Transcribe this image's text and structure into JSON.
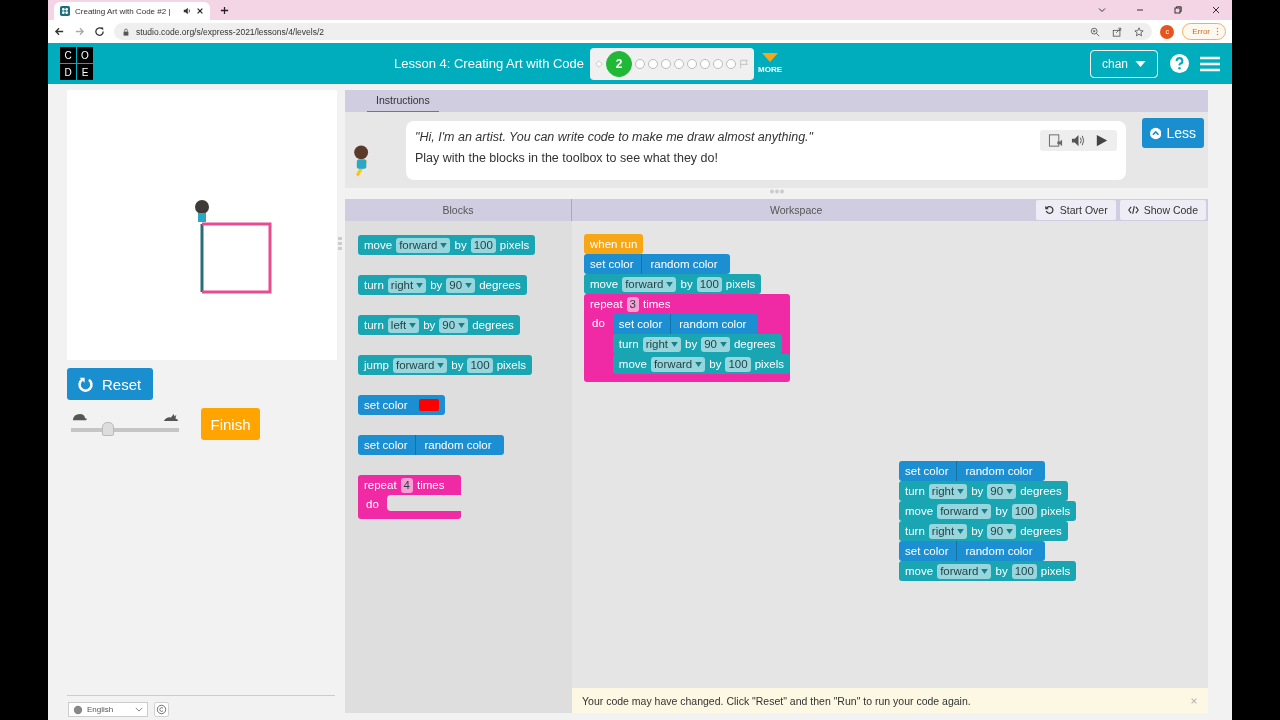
{
  "browser": {
    "tab_title": "Creating Art with Code #2 |",
    "url": "studio.code.org/s/express-2021/lessons/4/levels/2",
    "profile": "c",
    "error_button": "Error"
  },
  "header": {
    "logo": [
      "C",
      "O",
      "D",
      "E"
    ],
    "lesson_title": "Lesson 4: Creating Art with Code",
    "levels": [
      {
        "kind": "diamond",
        "selected": false
      },
      {
        "kind": "bubble",
        "label": "2",
        "selected": true
      },
      {
        "kind": "bubble",
        "selected": false
      },
      {
        "kind": "bubble",
        "selected": false
      },
      {
        "kind": "bubble",
        "selected": false
      },
      {
        "kind": "bubble",
        "selected": false
      },
      {
        "kind": "bubble",
        "selected": false
      },
      {
        "kind": "bubble",
        "selected": false
      },
      {
        "kind": "bubble",
        "selected": false
      },
      {
        "kind": "bubble",
        "selected": false
      },
      {
        "kind": "flag",
        "selected": false
      }
    ],
    "more": "MORE",
    "user": "chan"
  },
  "controls": {
    "reset": "Reset",
    "finish": "Finish",
    "speed": {
      "level": 0.34
    }
  },
  "instructions": {
    "tab": "Instructions",
    "quote": "\"Hi, I'm an artist. You can write code to make me draw almost anything.\"",
    "text": "Play with the blocks in the toolbox to see what they do!",
    "less_button": "Less"
  },
  "toolbox": {
    "title": "Blocks",
    "blocks": [
      {
        "kind": "motion",
        "parts": [
          {
            "kind": "text",
            "text": "move"
          },
          {
            "kind": "dropdown",
            "text": "forward"
          },
          {
            "kind": "text",
            "text": "by"
          },
          {
            "kind": "number",
            "text": "100"
          },
          {
            "kind": "text",
            "text": "pixels"
          }
        ]
      },
      {
        "kind": "motion",
        "parts": [
          {
            "kind": "text",
            "text": "turn"
          },
          {
            "kind": "dropdown",
            "text": "right"
          },
          {
            "kind": "text",
            "text": "by"
          },
          {
            "kind": "dropdown",
            "text": "90"
          },
          {
            "kind": "text",
            "text": "degrees"
          }
        ]
      },
      {
        "kind": "motion",
        "parts": [
          {
            "kind": "text",
            "text": "turn"
          },
          {
            "kind": "dropdown",
            "text": "left"
          },
          {
            "kind": "text",
            "text": "by"
          },
          {
            "kind": "dropdown",
            "text": "90"
          },
          {
            "kind": "text",
            "text": "degrees"
          }
        ]
      },
      {
        "kind": "motion",
        "parts": [
          {
            "kind": "text",
            "text": "jump"
          },
          {
            "kind": "dropdown",
            "text": "forward"
          },
          {
            "kind": "text",
            "text": "by"
          },
          {
            "kind": "number",
            "text": "100"
          },
          {
            "kind": "text",
            "text": "pixels"
          }
        ]
      },
      {
        "kind": "color",
        "parts": [
          {
            "kind": "text",
            "text": "set color"
          },
          {
            "kind": "swatch",
            "color": "#ff0000"
          }
        ]
      },
      {
        "kind": "color",
        "parts": [
          {
            "kind": "text",
            "text": "set color"
          },
          {
            "kind": "sub",
            "text": "random color"
          }
        ]
      },
      {
        "kind": "loop",
        "parts": [
          {
            "kind": "text",
            "text": "repeat"
          },
          {
            "kind": "number",
            "text": "4"
          },
          {
            "kind": "text",
            "text": "times"
          }
        ],
        "do_label": "do"
      }
    ]
  },
  "workspace": {
    "title": "Workspace",
    "start_over": "Start Over",
    "show_code": "Show Code",
    "stacks": [
      {
        "blocks": [
          {
            "kind": "event",
            "parts": [
              {
                "kind": "text",
                "text": "when run"
              }
            ]
          },
          {
            "kind": "color",
            "parts": [
              {
                "kind": "text",
                "text": "set color"
              },
              {
                "kind": "sub",
                "text": "random color"
              }
            ]
          },
          {
            "kind": "motion",
            "parts": [
              {
                "kind": "text",
                "text": "move"
              },
              {
                "kind": "dropdown",
                "text": "forward"
              },
              {
                "kind": "text",
                "text": "by"
              },
              {
                "kind": "number",
                "text": "100"
              },
              {
                "kind": "text",
                "text": "pixels"
              }
            ]
          },
          {
            "kind": "loop",
            "parts": [
              {
                "kind": "text",
                "text": "repeat"
              },
              {
                "kind": "number",
                "text": "3"
              },
              {
                "kind": "text",
                "text": "times"
              }
            ],
            "do_label": "do",
            "children": [
              {
                "kind": "color",
                "parts": [
                  {
                    "kind": "text",
                    "text": "set color"
                  },
                  {
                    "kind": "sub",
                    "text": "random color"
                  }
                ]
              },
              {
                "kind": "motion",
                "parts": [
                  {
                    "kind": "text",
                    "text": "turn"
                  },
                  {
                    "kind": "dropdown",
                    "text": "right"
                  },
                  {
                    "kind": "text",
                    "text": "by"
                  },
                  {
                    "kind": "dropdown",
                    "text": "90"
                  },
                  {
                    "kind": "text",
                    "text": "degrees"
                  }
                ]
              },
              {
                "kind": "motion",
                "parts": [
                  {
                    "kind": "text",
                    "text": "move"
                  },
                  {
                    "kind": "dropdown",
                    "text": "forward"
                  },
                  {
                    "kind": "text",
                    "text": "by"
                  },
                  {
                    "kind": "number",
                    "text": "100"
                  },
                  {
                    "kind": "text",
                    "text": "pixels"
                  }
                ]
              }
            ]
          }
        ]
      },
      {
        "blocks": [
          {
            "kind": "color",
            "parts": [
              {
                "kind": "text",
                "text": "set color"
              },
              {
                "kind": "sub",
                "text": "random color"
              }
            ]
          },
          {
            "kind": "motion",
            "parts": [
              {
                "kind": "text",
                "text": "turn"
              },
              {
                "kind": "dropdown",
                "text": "right"
              },
              {
                "kind": "text",
                "text": "by"
              },
              {
                "kind": "dropdown",
                "text": "90"
              },
              {
                "kind": "text",
                "text": "degrees"
              }
            ]
          },
          {
            "kind": "motion",
            "parts": [
              {
                "kind": "text",
                "text": "move"
              },
              {
                "kind": "dropdown",
                "text": "forward"
              },
              {
                "kind": "text",
                "text": "by"
              },
              {
                "kind": "number",
                "text": "100"
              },
              {
                "kind": "text",
                "text": "pixels"
              }
            ]
          },
          {
            "kind": "motion",
            "parts": [
              {
                "kind": "text",
                "text": "turn"
              },
              {
                "kind": "dropdown",
                "text": "right"
              },
              {
                "kind": "text",
                "text": "by"
              },
              {
                "kind": "dropdown",
                "text": "90"
              },
              {
                "kind": "text",
                "text": "degrees"
              }
            ]
          },
          {
            "kind": "color",
            "parts": [
              {
                "kind": "text",
                "text": "set color"
              },
              {
                "kind": "sub",
                "text": "random color"
              }
            ]
          },
          {
            "kind": "motion",
            "parts": [
              {
                "kind": "text",
                "text": "move"
              },
              {
                "kind": "dropdown",
                "text": "forward"
              },
              {
                "kind": "text",
                "text": "by"
              },
              {
                "kind": "number",
                "text": "100"
              },
              {
                "kind": "text",
                "text": "pixels"
              }
            ]
          }
        ]
      }
    ]
  },
  "notice": "Your code may have changed. Click \"Reset\" and then \"Run\" to run your code again.",
  "footer": {
    "language": "English"
  }
}
